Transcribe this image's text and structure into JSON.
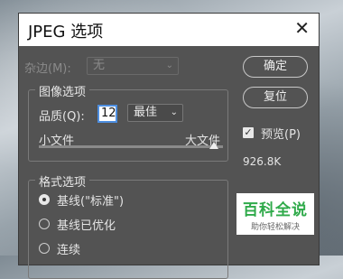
{
  "window": {
    "title": "JPEG 选项"
  },
  "matte": {
    "label": "杂边(M):",
    "value": "无"
  },
  "image_options": {
    "group_label": "图像选项",
    "quality_label": "品质(Q):",
    "quality_value": "12",
    "quality_preset": "最佳",
    "small_file_label": "小文件",
    "large_file_label": "大文件",
    "slider_level_fraction": 1.0
  },
  "format_options": {
    "group_label": "格式选项",
    "items": [
      {
        "label": "基线(\"标准\")",
        "selected": true
      },
      {
        "label": "基线已优化",
        "selected": false
      },
      {
        "label": "连续",
        "selected": false
      }
    ]
  },
  "buttons": {
    "ok": "确定",
    "reset": "复位"
  },
  "preview": {
    "label": "预览(P)",
    "checked": true,
    "file_size": "926.8K"
  },
  "watermark": {
    "main": "百科全说",
    "sub": "助你轻松解决"
  }
}
